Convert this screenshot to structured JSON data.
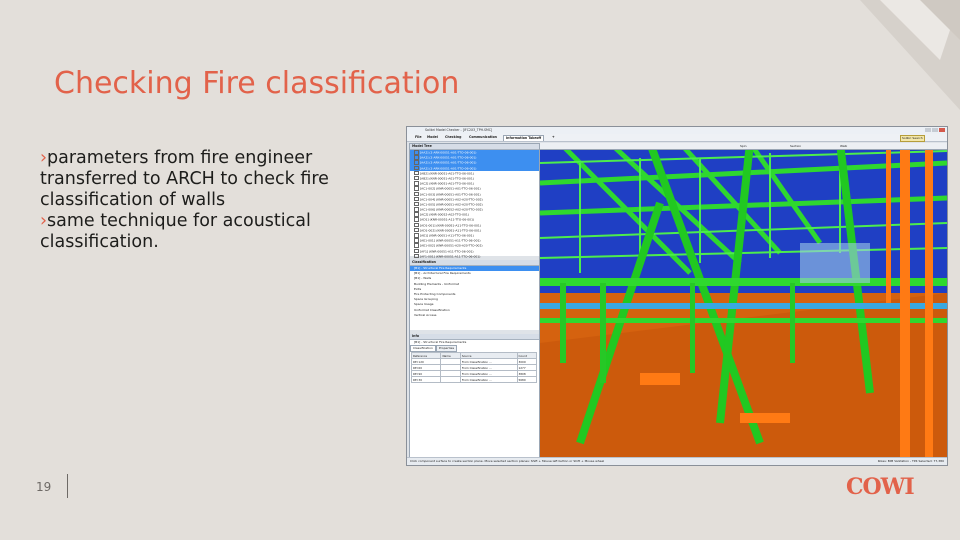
{
  "slide": {
    "title": "Checking Fire classification",
    "bullets": [
      "parameters from fire engineer transferred to ARCH to check fire classification of walls",
      "same technique for acoustical classification."
    ],
    "bullet_marker": "›",
    "page_number": "19",
    "logo": "COWI",
    "accent_color": "#e2624a"
  },
  "app": {
    "window_title": "Solibri Model Checker - [IFC2X3_TPH.SMC]",
    "menu": [
      "File",
      "Model",
      "Checking",
      "Communication",
      "Information Takeoff",
      "+"
    ],
    "active_menu_index": 4,
    "search_value": "Solibri Search",
    "model_tree": {
      "header": "Model Tree",
      "rows": [
        "[AA2] (3 ARK-00051-A01-TTO-06-001)",
        "[AA2] (3 ARK-00051-A01-TTO-06-001)",
        "[AA2] (3 ARK-00051-A01-TTO-06-001)",
        "[AA2] (3 ARK-00051-A01-TTO-06-001)",
        "[AB2] (KNR-00051-A01-TTO-06-001)",
        "[AB2] (KNR-00051-A01-TTO-06-001)",
        "[AC2] (KNR-00051-A01-TTO-06-001)",
        "[AC1-002] (KNR-00051-A01-TTO-06-001)",
        "[AC1-003] (KNR-00051-A01-TTO-06-001)",
        "[AC1-004] (KNR-00051-A02-A20-TTO-002)",
        "[AC1-005] (KNR-00051-A02-A20-TTO-002)",
        "[AC1-006] (KNR-00052-A02-A20-TTO-002)",
        "[AC2] (KNR-00052-A02-TTO-001)",
        "[AD1] (KNR-00051-A11-TTO-06-001)",
        "[AD1-001] (KNR-00051-A11-TTO-06-001)",
        "[AD1-002] (KNR-00051-A11-TTO-06-001)",
        "[AE1] (KNR-00051-A11-TTO-06-001)",
        "[AE1-001] (KNR-00051-A11-TTO-06-001)",
        "[AE1-002] (KNR-00051-A20-A20-TTO-002)",
        "[AF1] (KNR-00051-A11-TTO-06-001)",
        "[AF1-001] (KNR-00051-A11-TTO-06-001)"
      ],
      "selected_count": 4
    },
    "classification": {
      "header": "Classification",
      "rows": [
        "[B1] - Structural Fire Requirements",
        "[B1] - Architectural Fire Requirements",
        "[B1] - Walls",
        "Building Elements - Uniformat",
        "Exits",
        "Fire Protecting Components",
        "Space Grouping",
        "Space Usage",
        "Uniformat Classification",
        "Vertical Access"
      ]
    },
    "info": {
      "header": "Info",
      "subject": "[B1] - Structural Fire Requirements",
      "tabs": [
        "Classification",
        "Properties"
      ],
      "columns": [
        "Reference",
        "Name",
        "Source",
        "Count"
      ],
      "rows": [
        [
          "REI 120",
          "",
          "From Classification ...",
          "3009"
        ],
        [
          "REI 60",
          "",
          "From Classification ...",
          "1277"
        ],
        [
          "REI 90",
          "",
          "From Classification ...",
          "3808"
        ],
        [
          "REI 30",
          "",
          "From Classification ...",
          "5680"
        ]
      ]
    },
    "viewport_toolbar": [
      "Spin",
      "Section",
      "Walk"
    ],
    "status_left": "Click component surface to create section plane. Move selected section planes: Shift + Mouse left button or Shift + Mouse wheel",
    "status_right": "Roles: BIM Validation - TP4    Selected: 77,380"
  }
}
